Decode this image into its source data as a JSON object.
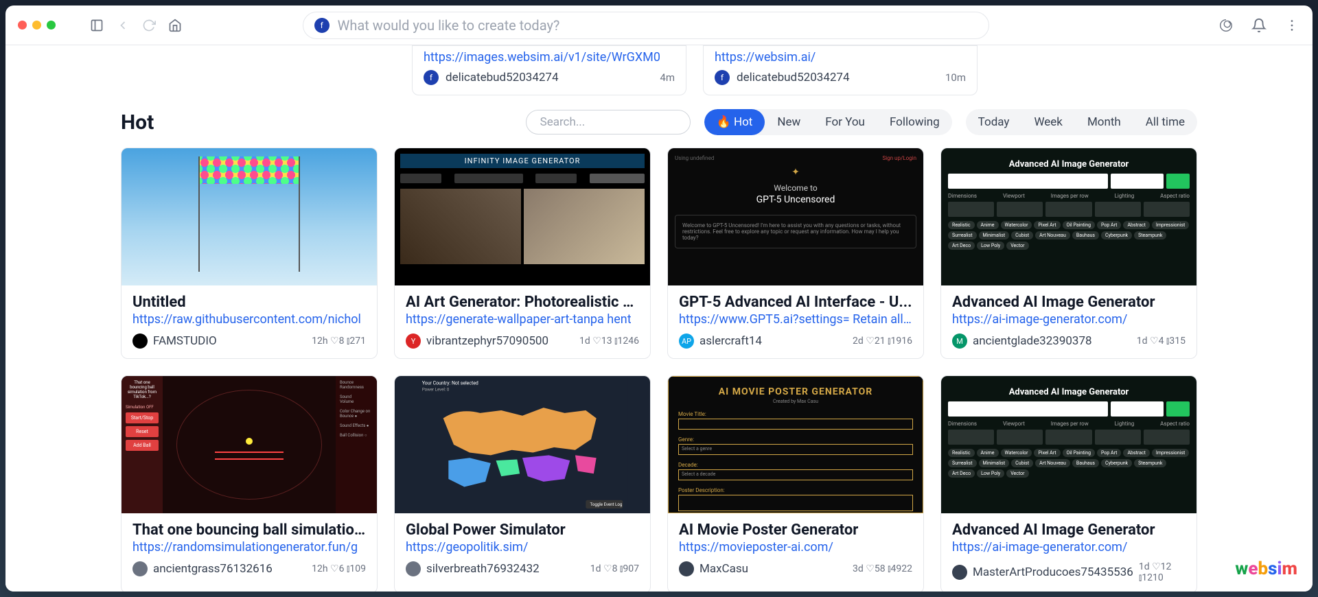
{
  "searchPlaceholder": "What would you like to create today?",
  "avatarLetter": "f",
  "topCards": [
    {
      "url": "https://images.websim.ai/v1/site/WrGXM0",
      "who": "delicatebud52034274",
      "time": "4m",
      "av": "f",
      "avbg": "#1e40af"
    },
    {
      "url": "https://websim.ai/",
      "who": "delicatebud52034274",
      "time": "10m",
      "av": "f",
      "avbg": "#1e40af"
    }
  ],
  "hotTitle": "Hot",
  "filterSearchPlaceholder": "Search...",
  "sortTabs": [
    "Hot",
    "New",
    "For You",
    "Following"
  ],
  "timeTabs": [
    "Today",
    "Week",
    "Month",
    "All time"
  ],
  "cards": [
    {
      "title": "Untitled",
      "url": "https://raw.githubusercontent.com/nichol",
      "author": "FAMSTUDIO",
      "avbg": "#000",
      "avtxt": "",
      "stats": "12h ♡8 ⫾271",
      "thumb": "th0"
    },
    {
      "title": "AI Art Generator: Photorealistic a...",
      "url": "https://generate-wallpaper-art-tanpa hent",
      "author": "vibrantzephyr57090500",
      "avbg": "#dc2626",
      "avtxt": "Y",
      "stats": "1d ♡13 ⫾1246",
      "thumb": "th1"
    },
    {
      "title": "GPT-5 Advanced AI Interface - U...",
      "url": "https://www.GPT5.ai?settings= Retain all s",
      "author": "aslercraft14",
      "avbg": "#0ea5e9",
      "avtxt": "AP",
      "stats": "2d ♡21 ⫾1916",
      "thumb": "th2"
    },
    {
      "title": "Advanced AI Image Generator",
      "url": "https://ai-image-generator.com/",
      "author": "ancientglade32390378",
      "avbg": "#059669",
      "avtxt": "M",
      "stats": "1d ♡4 ⫾315",
      "thumb": "th3"
    },
    {
      "title": "That one bouncing ball simulatio...",
      "url": "https://randomsimulationgenerator.fun/g",
      "author": "ancientgrass76132616",
      "avbg": "#6b7280",
      "avtxt": "",
      "stats": "12h ♡6 ⫾109",
      "thumb": "th4"
    },
    {
      "title": "Global Power Simulator",
      "url": "https://geopolitik.sim/",
      "author": "silverbreath76932432",
      "avbg": "#6b7280",
      "avtxt": "",
      "stats": "1d ♡8 ⫾907",
      "thumb": "th5"
    },
    {
      "title": "AI Movie Poster Generator",
      "url": "https://movieposter-ai.com/",
      "author": "MaxCasu",
      "avbg": "#374151",
      "avtxt": "",
      "stats": "3d ♡58 ⫾4922",
      "thumb": "th6"
    },
    {
      "title": "Advanced AI Image Generator",
      "url": "https://ai-image-generator.com/",
      "author": "MasterArtProducoes75435536",
      "avbg": "#374151",
      "avtxt": "",
      "stats": "1d ♡12 ⫾1210",
      "thumb": "th3"
    }
  ],
  "logo": "websim",
  "thumbText": {
    "th1_banner": "INFINITY IMAGE GENERATOR",
    "th2_t1": "Welcome to",
    "th2_t2": "GPT-5 Uncensored",
    "th3_hdr": "Advanced AI Image Generator",
    "th6_tt": "AI MOVIE POSTER GENERATOR",
    "th6_sub": "Created by Max Casu",
    "th6_f1": "Movie Title:",
    "th6_f2": "Genre:",
    "th6_f3": "Decade:",
    "th6_f4": "Poster Description:"
  }
}
